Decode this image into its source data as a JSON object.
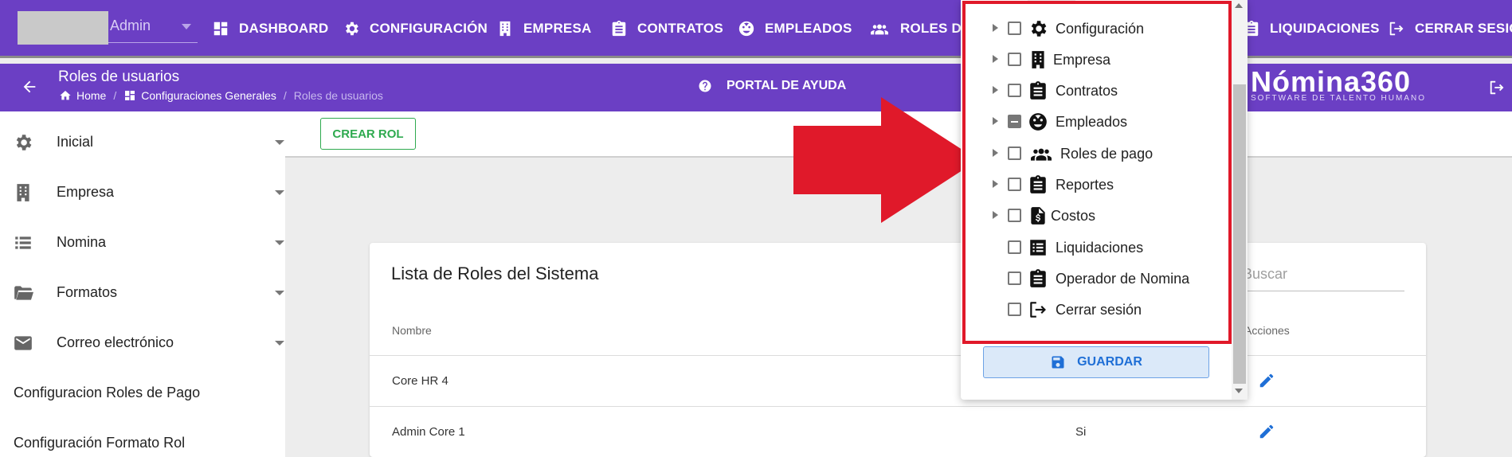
{
  "topnav": {
    "user_label": "Admin",
    "items": [
      {
        "label": "DASHBOARD",
        "icon": "dashboard-icon"
      },
      {
        "label": "CONFIGURACIÓN",
        "icon": "gear-icon"
      },
      {
        "label": "EMPRESA",
        "icon": "building-icon"
      },
      {
        "label": "CONTRATOS",
        "icon": "clipboard-icon"
      },
      {
        "label": "EMPLEADOS",
        "icon": "face-icon"
      },
      {
        "label": "ROLES DE",
        "icon": "people-icon"
      },
      {
        "label": "LIQUIDACIONES",
        "icon": "clipboard-icon"
      },
      {
        "label": "CERRAR SESIÓN",
        "icon": "logout-icon"
      }
    ]
  },
  "subheader": {
    "title": "Roles de usuarios",
    "breadcrumbs": [
      "Home",
      "Configuraciones Generales",
      "Roles de usuarios"
    ],
    "help": "PORTAL DE AYUDA",
    "brand_name": "Nómina360",
    "brand_tagline": "SOFTWARE DE TALENTO HUMANO"
  },
  "sidebar": {
    "items": [
      {
        "label": "Inicial",
        "icon": "gear-icon"
      },
      {
        "label": "Empresa",
        "icon": "building-icon"
      },
      {
        "label": "Nomina",
        "icon": "list-icon"
      },
      {
        "label": "Formatos",
        "icon": "folder-icon"
      },
      {
        "label": "Correo electrónico",
        "icon": "mail-icon"
      }
    ],
    "links": [
      "Configuracion Roles de Pago",
      "Configuración Formato Rol"
    ]
  },
  "main": {
    "create_button": "CREAR ROL",
    "card_title": "Lista de Roles del Sistema",
    "search_placeholder": "Buscar",
    "columns": [
      "Nombre",
      "Acciones"
    ],
    "rows": [
      {
        "name": "Core HR 4",
        "status": ""
      },
      {
        "name": "Admin Core 1",
        "status": "Si"
      }
    ]
  },
  "dropdown": {
    "items": [
      {
        "label": "Configuración",
        "icon": "gear-icon",
        "expandable": true,
        "state": "unchecked"
      },
      {
        "label": "Empresa",
        "icon": "building-icon",
        "expandable": true,
        "state": "unchecked"
      },
      {
        "label": "Contratos",
        "icon": "clipboard-icon",
        "expandable": true,
        "state": "unchecked"
      },
      {
        "label": "Empleados",
        "icon": "face-icon",
        "expandable": true,
        "state": "indeterminate"
      },
      {
        "label": "Roles de pago",
        "icon": "people-icon",
        "expandable": true,
        "state": "unchecked"
      },
      {
        "label": "Reportes",
        "icon": "clipboard-icon",
        "expandable": true,
        "state": "unchecked"
      },
      {
        "label": "Costos",
        "icon": "invoice-icon",
        "expandable": true,
        "state": "unchecked"
      },
      {
        "label": "Liquidaciones",
        "icon": "list-box-icon",
        "expandable": false,
        "state": "unchecked"
      },
      {
        "label": "Operador de Nomina",
        "icon": "clipboard-icon",
        "expandable": false,
        "state": "unchecked"
      },
      {
        "label": "Cerrar sesión",
        "icon": "logout-icon",
        "expandable": false,
        "state": "unchecked"
      }
    ],
    "save_button": "GUARDAR"
  },
  "colors": {
    "primary_purple": "#6b3fc4",
    "highlight_red": "#e0192a",
    "success_green": "#2eaa4f",
    "action_blue": "#1f6fd6"
  }
}
